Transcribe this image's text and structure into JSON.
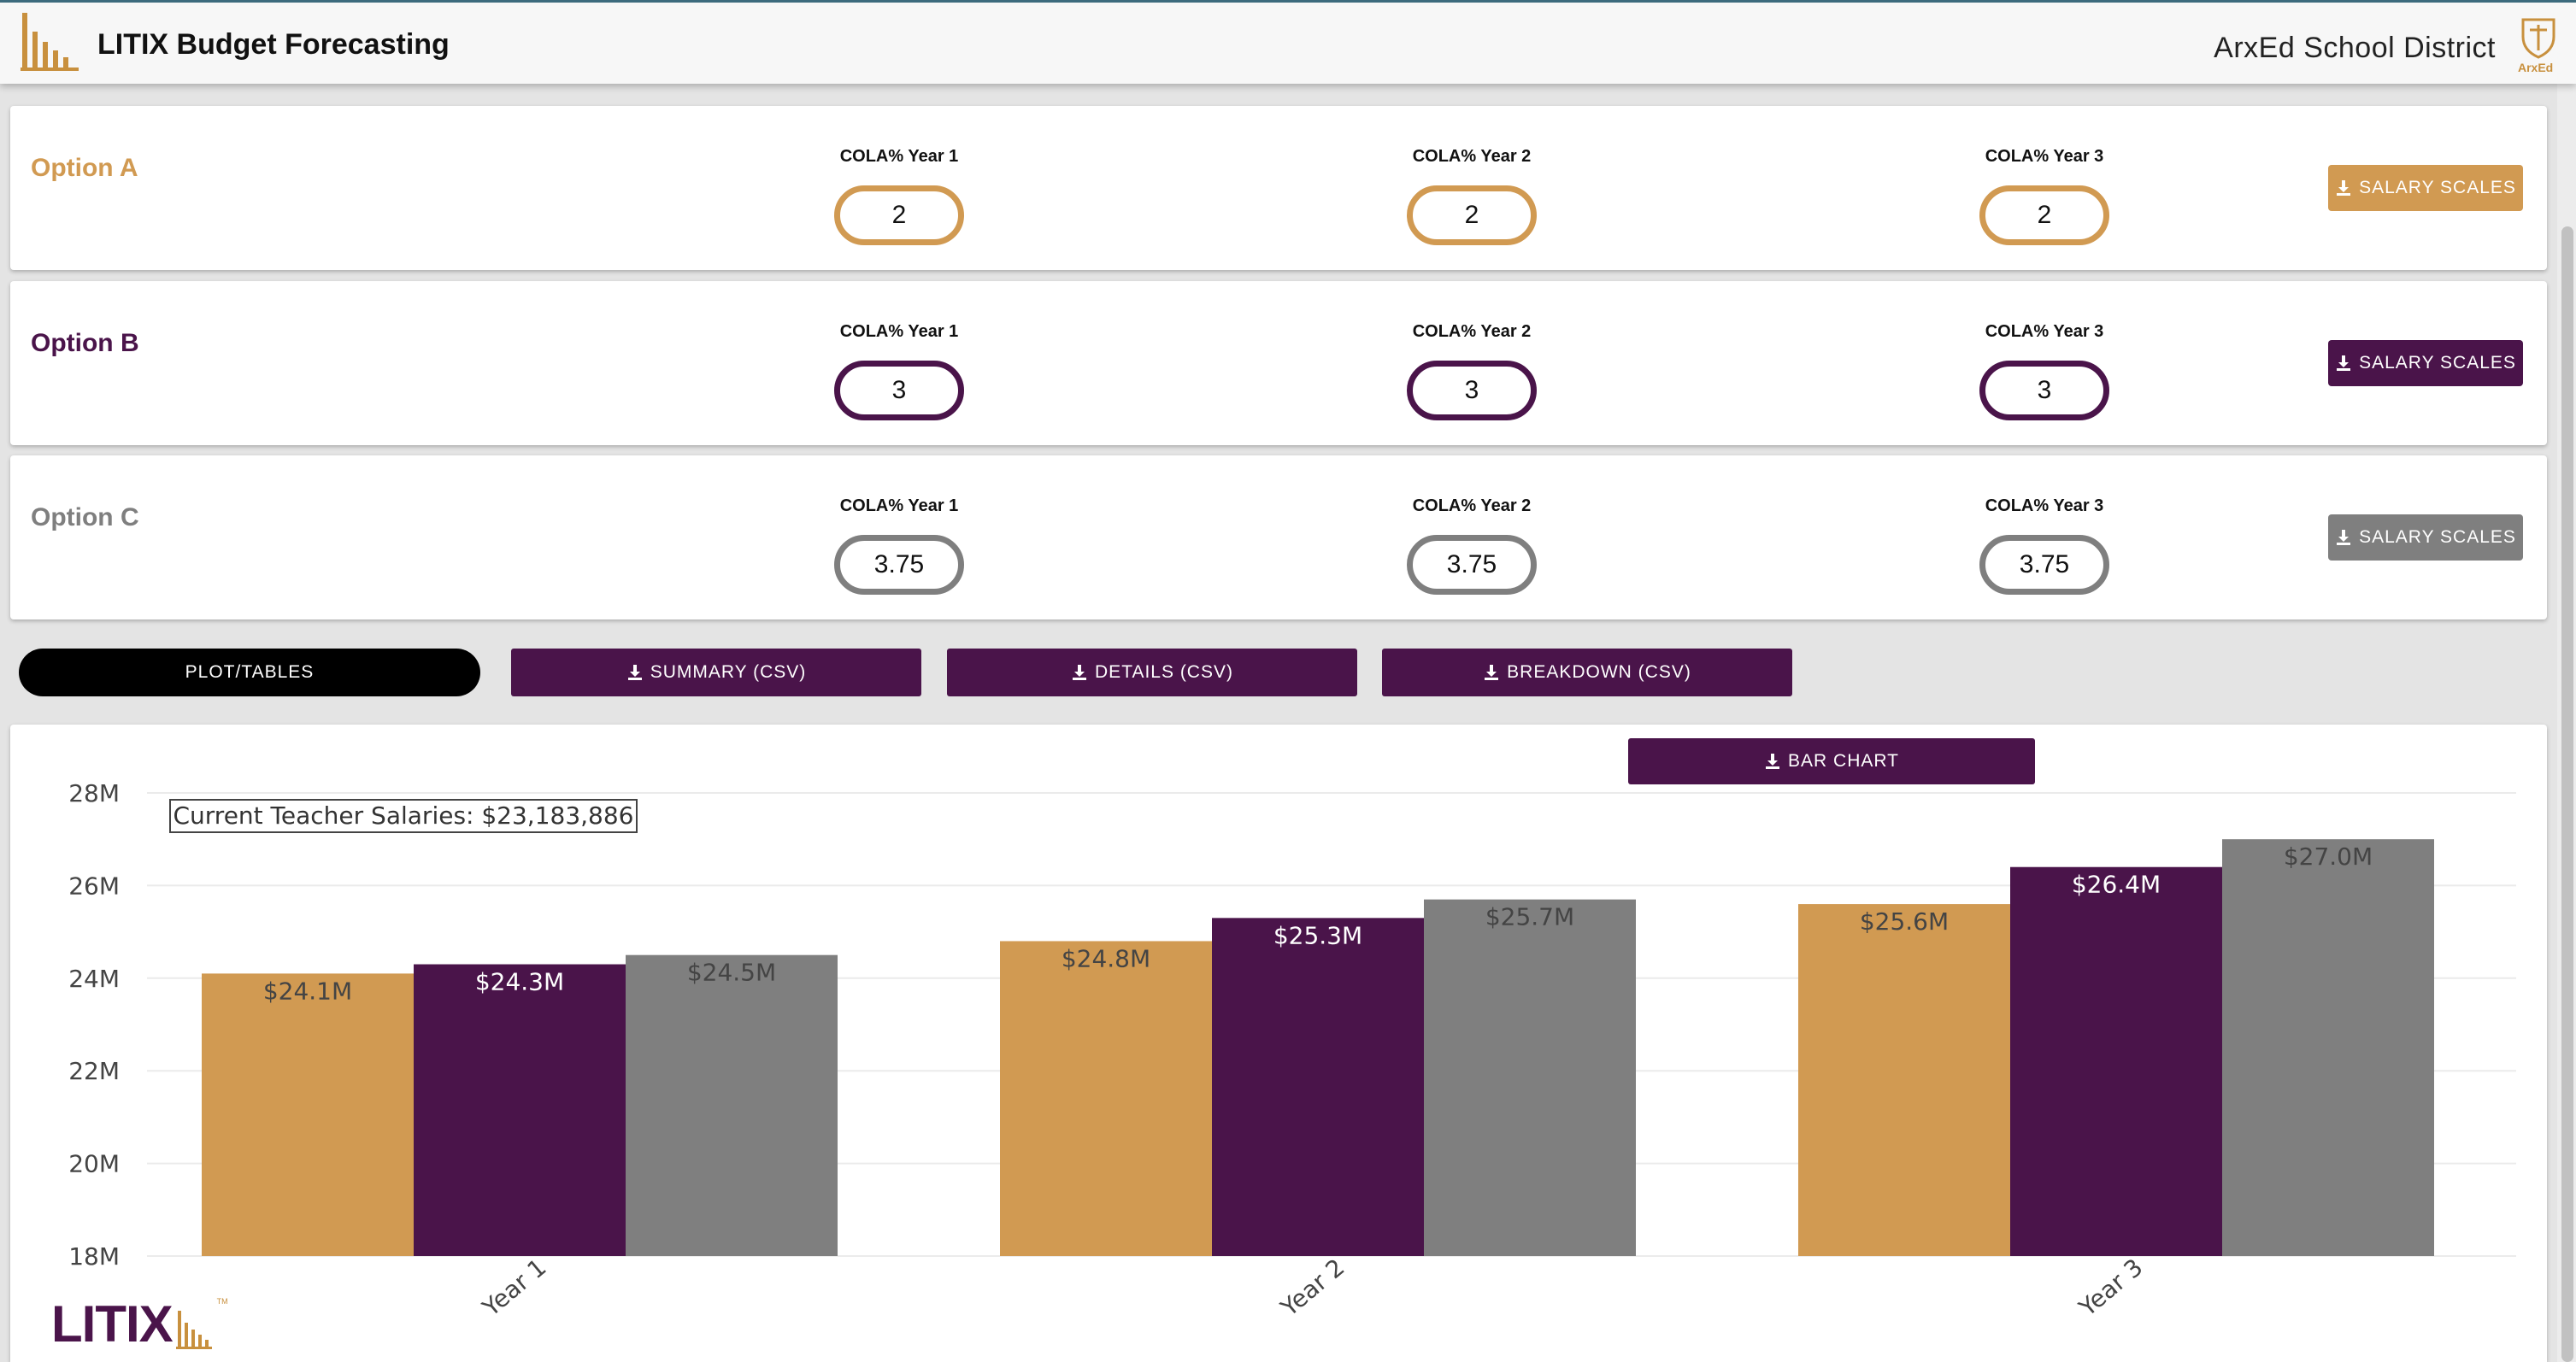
{
  "header": {
    "title": "LITIX Budget Forecasting",
    "district": "ArxEd School District",
    "logo_tag": "ArxEd"
  },
  "colors": {
    "option_a": "#d19a52",
    "option_b": "#4a144a",
    "option_c": "#7f7f7f",
    "accent": "#4a144a"
  },
  "options": [
    {
      "name": "Option A",
      "fields": [
        {
          "label": "COLA% Year 1",
          "value": "2"
        },
        {
          "label": "COLA% Year 2",
          "value": "2"
        },
        {
          "label": "COLA% Year 3",
          "value": "2"
        }
      ],
      "salary_label": "SALARY SCALES"
    },
    {
      "name": "Option B",
      "fields": [
        {
          "label": "COLA% Year 1",
          "value": "3"
        },
        {
          "label": "COLA% Year 2",
          "value": "3"
        },
        {
          "label": "COLA% Year 3",
          "value": "3"
        }
      ],
      "salary_label": "SALARY SCALES"
    },
    {
      "name": "Option C",
      "fields": [
        {
          "label": "COLA% Year 1",
          "value": "3.75"
        },
        {
          "label": "COLA% Year 2",
          "value": "3.75"
        },
        {
          "label": "COLA% Year 3",
          "value": "3.75"
        }
      ],
      "salary_label": "SALARY SCALES"
    }
  ],
  "actions": {
    "plot_tables": "PLOT/TABLES",
    "summary_csv": "SUMMARY (CSV)",
    "details_csv": "DETAILS (CSV)",
    "breakdown_csv": "BREAKDOWN (CSV)",
    "bar_chart": "BAR CHART"
  },
  "footer": {
    "logo_text": "LITIX",
    "trademark": "TM"
  },
  "chart_data": {
    "type": "bar",
    "categories": [
      "Year 1",
      "Year 2",
      "Year 3"
    ],
    "series": [
      {
        "values": [
          24.1,
          24.8,
          25.6
        ],
        "labels": [
          "$24.1M",
          "$24.8M",
          "$25.6M"
        ],
        "color": "#d19a52"
      },
      {
        "values": [
          24.3,
          25.3,
          26.4
        ],
        "labels": [
          "$24.3M",
          "$25.3M",
          "$26.4M"
        ],
        "color": "#4a144a"
      },
      {
        "values": [
          24.5,
          25.7,
          27.0
        ],
        "labels": [
          "$24.5M",
          "$25.7M",
          "$27.0M"
        ],
        "color": "#7f7f7f"
      }
    ],
    "ylim": [
      18,
      28
    ],
    "yticks": [
      18,
      20,
      22,
      24,
      26,
      28
    ],
    "ytick_labels": [
      "18M",
      "20M",
      "22M",
      "24M",
      "26M",
      "28M"
    ],
    "annotation": "Current Teacher Salaries: $23,183,886",
    "grid": true
  }
}
